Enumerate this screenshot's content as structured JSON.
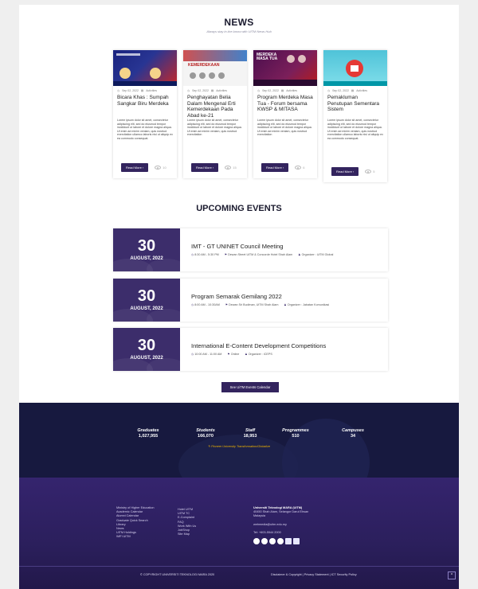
{
  "news": {
    "heading": "NEWS",
    "subheading": "Always stay in-the-know with UiTM News Hub",
    "read_more_label": "Read More ›",
    "items": [
      {
        "date": "Sep 02, 2022",
        "category": "Activities",
        "title": "Bicara Khas : Sumpah Sangkar Biru Merdeka",
        "excerpt": "Lorem ipsum dolor sit amet, consectetur adipiscing elit, sed do eiusmod tempor incididunt ut labore et dolore magna aliqua. Ut enim ad minim veniam, quis nostrud exercitation ullamco laboris nisi ut aliquip ex ea commodo consequat.",
        "views": "10"
      },
      {
        "date": "Sep 02, 2022",
        "category": "Activities",
        "title": "Penghayatan Belia Dalam Mengenal Erti Kemerdekaan Pada Abad ke-21",
        "excerpt": "Lorem ipsum dolor sit amet, consectetur adipiscing elit, sed do eiusmod tempor incididunt ut labore et dolore magna aliqua. Ut enim ad minim veniam, quis nostrud exercitation",
        "views": "15"
      },
      {
        "date": "Sep 02, 2022",
        "category": "Activities",
        "title": "Program Merdeka Masa Tua - Forum bersama KWSP & MITASA",
        "excerpt": "Lorem ipsum dolor sit amet, consectetur adipiscing elit, sed do eiusmod tempor incididunt ut labore et dolore magna aliqua. Ut enim ad minim veniam, quis nostrud exercitation",
        "views": "6"
      },
      {
        "date": "Sep 02, 2022",
        "category": "Activities",
        "title": "Pemakluman Penutupan Sementara Sistem",
        "excerpt": "Lorem ipsum dolor sit amet, consectetur adipiscing elit, sed do eiusmod tempor incididunt ut labore et dolore magna aliqua. Ut enim ad minim veniam, quis nostrud exercitation ullamco laboris nisi ut aliquip ex ea commodo consequat.",
        "views": "5"
      }
    ],
    "image_captions": [
      "",
      "KEMERDEKAAN",
      "MERDEKA MASA TUA",
      ""
    ]
  },
  "events": {
    "heading": "UPCOMING EVENTS",
    "calendar_button": "See UiTM Events Calendar",
    "items": [
      {
        "day": "30",
        "month": "AUGUST, 2022",
        "title": "IMT - GT UNINET Council Meeting",
        "time": "8:30 AM - 5:30 PM",
        "venue": "Dewan Street UiTM & Concorde Hotel Shah Alam",
        "organizer": "Organizer : UiTM Global"
      },
      {
        "day": "30",
        "month": "AUGUST, 2022",
        "title": "Program Semarak Gemilang 2022",
        "time": "8:00 AM - 10:30AM",
        "venue": "Dewan Sri Budiman, UiTM Shah Alam",
        "organizer": "Organizer : Jabatan Komunikasi"
      },
      {
        "day": "30",
        "month": "AUGUST, 2022",
        "title": "International E-Content Development Competitions",
        "time": "10:00 AM - 11:00 AM",
        "venue": "Online",
        "organizer": "Organizer : iCEPS"
      }
    ]
  },
  "stats": {
    "items": [
      {
        "label": "Graduates",
        "value": "1,027,955"
      },
      {
        "label": "Students",
        "value": "166,070"
      },
      {
        "label": "Staff",
        "value": "18,953"
      },
      {
        "label": "Programmes",
        "value": "510"
      },
      {
        "label": "Campuses",
        "value": "34"
      }
    ],
    "tagline": "✎ Pioneer University Transformation/Globalize"
  },
  "footer": {
    "col1": [
      "Ministry of Higher Education",
      "Academic Calendar",
      "Alumni Calendar",
      "Graduate Quick Search",
      "Library",
      "News",
      "UiTM Holdings",
      "WiFi UiTM"
    ],
    "col2": [
      "Hotel UiTM",
      "UiTM TC",
      "E-Complaint",
      "FAQ",
      "Work With Us",
      "JobShop",
      "Site Map"
    ],
    "university_name": "Universiti Teknologi MARA (UiTM)",
    "address_line1": "40450 Shah Alam, Selangor Darul Ehsan",
    "address_line2": "Malaysia",
    "email": "webmedia@uitm.edu.my",
    "phone": "Tel: +603-5544 2000",
    "social_icons": [
      "facebook-icon",
      "twitter-icon",
      "instagram-icon",
      "youtube-icon",
      "x-icon",
      "linkedin-icon"
    ],
    "copyright": "© COPYRIGHT UNIVERSITI TEKNOLOGI MARA 2020",
    "legal": "Disclaimer & Copyright | Privacy Statement | ICT Security Policy",
    "to_top": "^"
  },
  "colors": {
    "primary": "#33245e",
    "stats_bg": "#17193f",
    "footer_bg": "#35246e",
    "accent": "#f0b400"
  }
}
